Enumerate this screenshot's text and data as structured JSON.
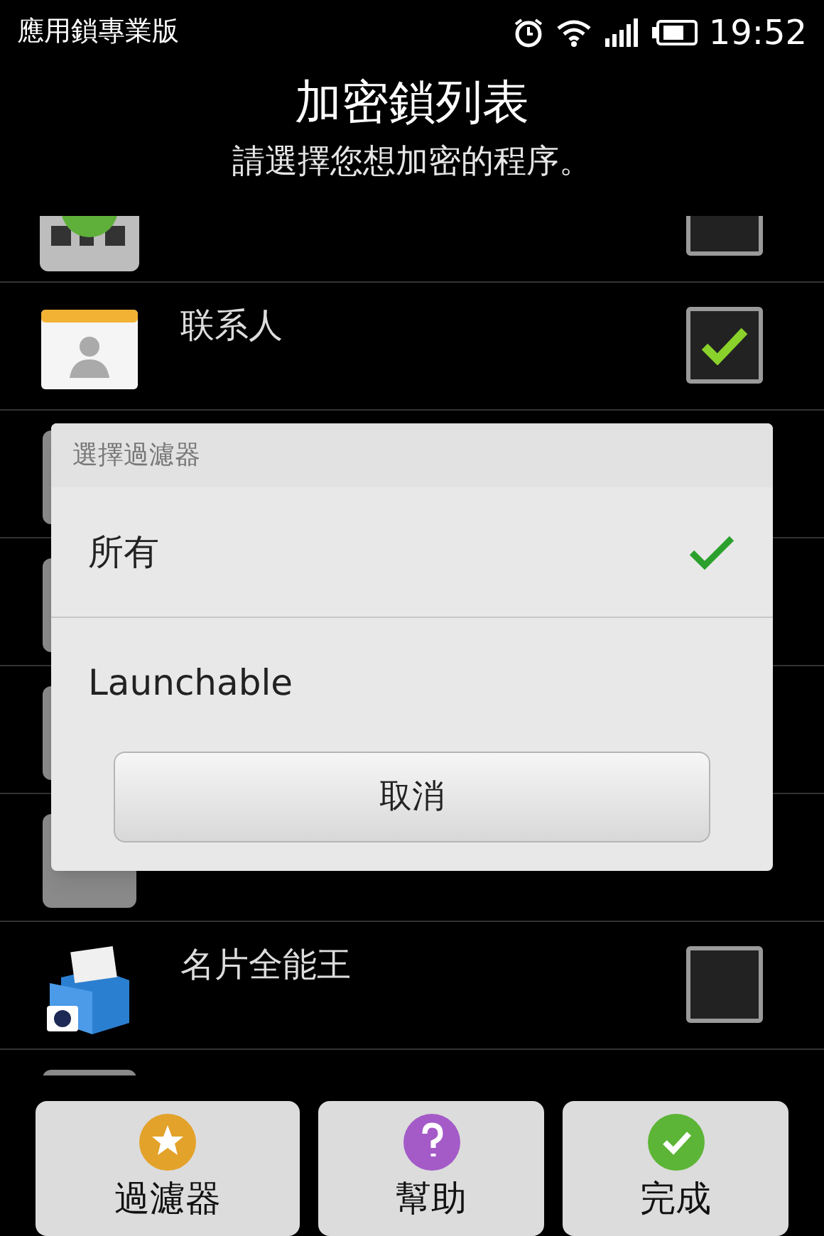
{
  "status_bar": {
    "app_name": "應用鎖專業版",
    "time": "19:52"
  },
  "header": {
    "title": "加密鎖列表",
    "subtitle": "請選擇您想加密的程序。"
  },
  "apps": [
    {
      "kind": "qr",
      "checked": false
    },
    {
      "kind": "contacts",
      "name": "联系人",
      "checked": true
    },
    {
      "kind": "covered"
    },
    {
      "kind": "covered"
    },
    {
      "kind": "covered"
    },
    {
      "kind": "covered"
    },
    {
      "kind": "card",
      "name": "名片全能王",
      "checked": false
    },
    {
      "kind": "covered"
    }
  ],
  "dialog": {
    "title": "選擇過濾器",
    "options": [
      {
        "label": "所有",
        "selected": true
      },
      {
        "label": "Launchable",
        "selected": false
      }
    ],
    "cancel": "取消"
  },
  "buttons": [
    {
      "kind": "filter",
      "label": "過濾器"
    },
    {
      "kind": "help",
      "label": "幫助"
    },
    {
      "kind": "done",
      "label": "完成"
    }
  ]
}
